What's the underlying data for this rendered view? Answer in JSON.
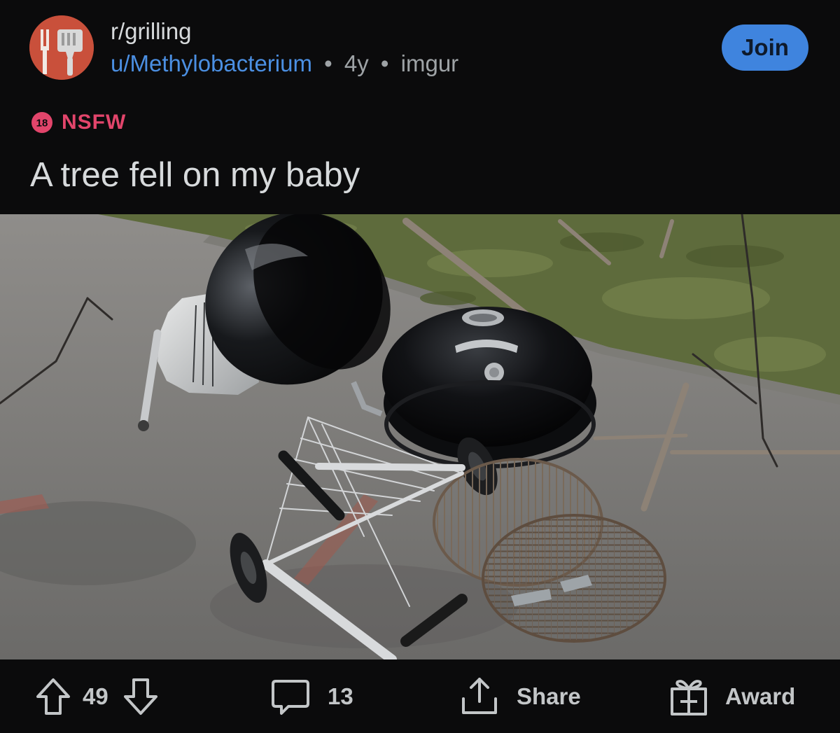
{
  "post": {
    "subreddit": "r/grilling",
    "username": "u/Methylobacterium",
    "separator": "•",
    "age": "4y",
    "source": "imgur",
    "join_label": "Join",
    "nsfw_badge": "18",
    "nsfw_label": "NSFW",
    "title": "A tree fell on my baby"
  },
  "actions": {
    "votes": "49",
    "comments": "13",
    "share_label": "Share",
    "award_label": "Award"
  },
  "icons": {
    "avatar": "grill-tools-icon",
    "upvote": "arrow-up-icon",
    "downvote": "arrow-down-icon",
    "comments": "comment-bubble-icon",
    "share": "share-icon",
    "award": "gift-icon"
  },
  "colors": {
    "background": "#0b0b0c",
    "join_button": "#3f84de",
    "username": "#4b8fe2",
    "nsfw": "#e2456b",
    "avatar": "#c9503b"
  }
}
